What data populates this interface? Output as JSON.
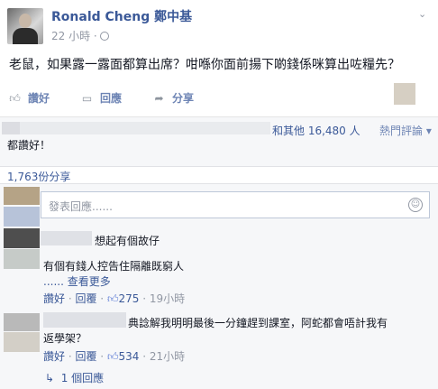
{
  "post": {
    "author": "Ronald Cheng 鄭中基",
    "time": "22 小時 ·",
    "text": "老鼠，如果露一露面都算出席？咁喺你面前揚下啲錢係咪算出咗糧先？"
  },
  "actions": {
    "like": "讚好",
    "comment": "回應",
    "share": "分享"
  },
  "likes": {
    "others": "和其他 16,480 人",
    "sort": "熱門評論 ▾",
    "snippet": "都讚好！"
  },
  "shares": "1,763份分享",
  "reply_box": {
    "placeholder": "發表回應......"
  },
  "comments": [
    {
      "text": "想起有個故仔",
      "line2": "有個有錢人控告住隔離既窮人",
      "more": "...... 查看更多",
      "like": "讚好",
      "reply": "回覆",
      "likes": "275",
      "time": "19小時"
    },
    {
      "text": "典諗解我明明最後一分鐘趕到課室，阿蛇都會唔計我有",
      "line2": "返學架？",
      "like": "讚好",
      "reply": "回覆",
      "likes": "534",
      "time": "21小時",
      "replies": "1 個回應"
    }
  ]
}
